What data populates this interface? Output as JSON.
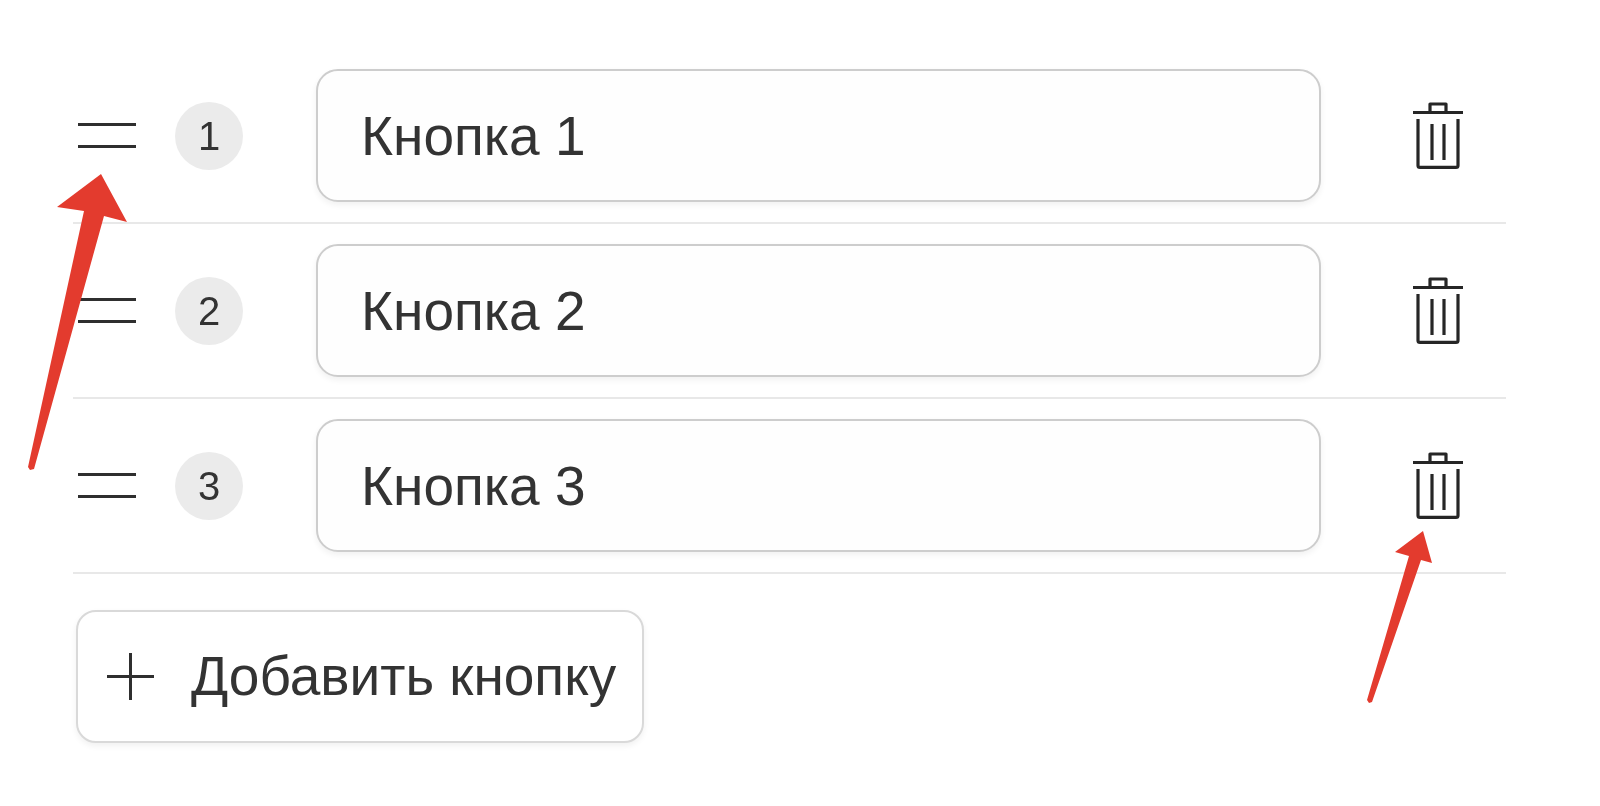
{
  "rows": [
    {
      "number": "1",
      "value": "Кнопка 1"
    },
    {
      "number": "2",
      "value": "Кнопка 2"
    },
    {
      "number": "3",
      "value": "Кнопка 3"
    }
  ],
  "add_button": {
    "label": "Добавить кнопку"
  }
}
